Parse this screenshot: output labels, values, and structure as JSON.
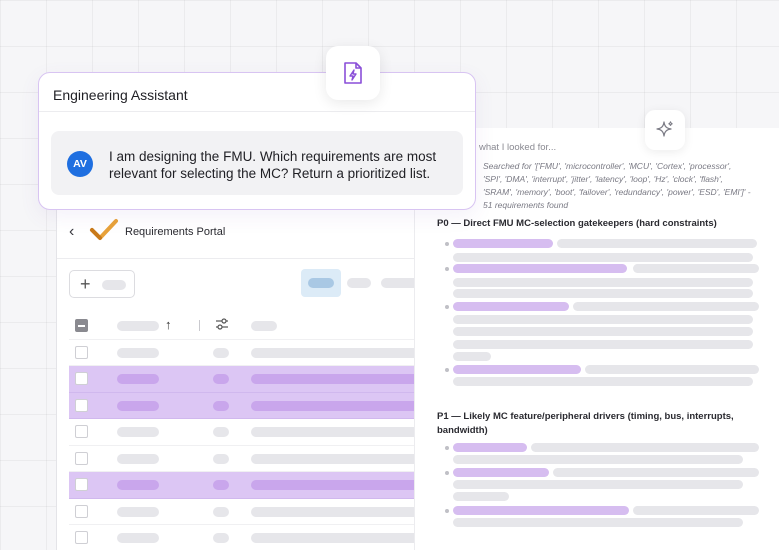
{
  "assistant": {
    "title": "Engineering Assistant",
    "avatar_initials": "AV",
    "message": "I am designing the FMU. Which requirements are most relevant for selecting the MC? Return a prioritized list."
  },
  "portal": {
    "title": "Requirements Portal",
    "back_icon": "chevron-left-icon",
    "add_icon": "plus-icon",
    "sort_icon": "arrow-up-icon",
    "filter_icon": "sliders-icon",
    "selected_rows": [
      2,
      3,
      6
    ]
  },
  "results": {
    "what_looked": "what I looked for...",
    "searched": "Searched for '['FMU', 'microcontroller', 'MCU', 'Cortex', 'processor', 'SPI', 'DMA', 'interrupt', 'jitter', 'latency', 'loop', 'Hz', 'clock', 'flash', 'SRAM', 'memory', 'boot', 'failover', 'redundancy', 'power', 'ESD', 'EMI']' - 51 requirements found",
    "p0_heading": "P0 — Direct FMU MC-selection gatekeepers (hard constraints)",
    "p1_heading": "P1 — Likely MC feature/peripheral drivers (timing, bus, interrupts, bandwidth)"
  },
  "colors": {
    "accent_purple": "#c9a6ec",
    "selected_row": "#dcc6f4",
    "avatar_blue": "#1f6fe0"
  }
}
